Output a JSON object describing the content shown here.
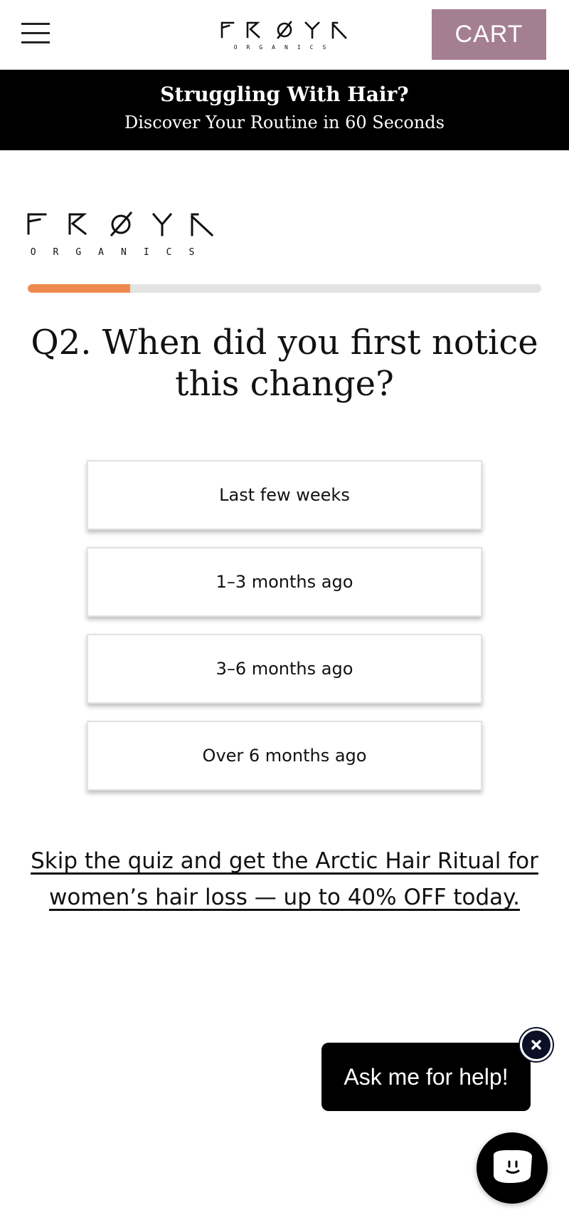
{
  "header": {
    "brand_name": "FRØYK",
    "brand_sub": "ORGANICS",
    "cart_label": "CART",
    "menu_icon": "hamburger-menu-icon"
  },
  "promo": {
    "title": "Struggling With Hair?",
    "subtitle": "Discover Your Routine in 60 Seconds"
  },
  "quiz": {
    "progress": 0.2,
    "progress_color": "#ee8a4d",
    "question": "Q2. When did you first notice this change?",
    "options": [
      "Last few weeks",
      "1–3 months ago",
      "3–6 months ago",
      "Over 6 months ago"
    ],
    "skip_text": "Skip the quiz and get the Arctic Hair Ritual for women’s hair loss — up to 40% OFF today."
  },
  "chat": {
    "bubble_text": "Ask me for help!",
    "close_icon": "close-icon",
    "launcher_icon": "chat-face-icon"
  },
  "colors": {
    "cart": "#a47f91",
    "promo_bg": "#000000",
    "accent": "#ee8a4d"
  }
}
